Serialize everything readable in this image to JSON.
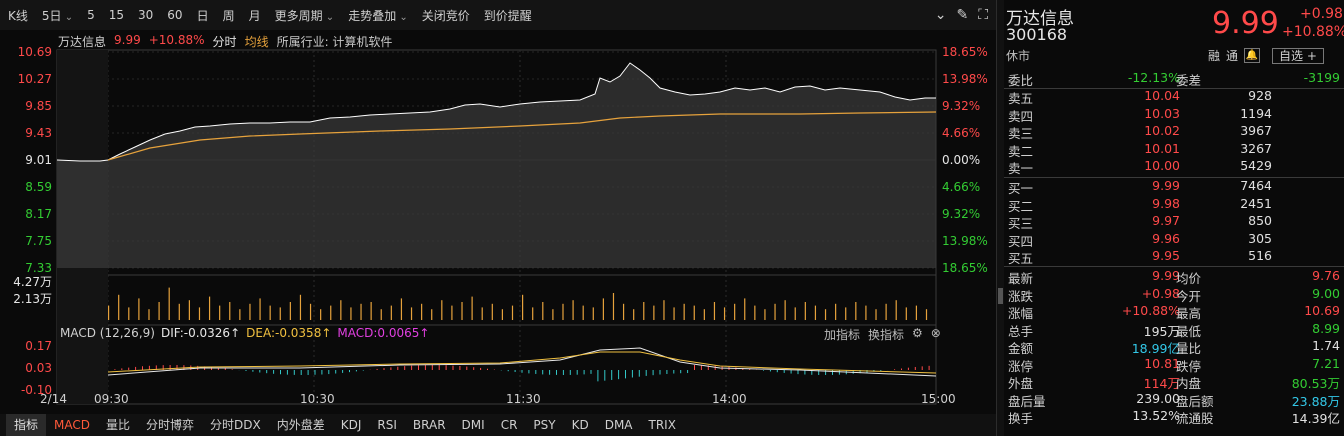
{
  "toolbar": {
    "items": [
      "K线",
      "5日",
      "5",
      "15",
      "30",
      "60",
      "日",
      "周",
      "月",
      "更多周期",
      "走势叠加",
      "关闭竞价",
      "到价提醒"
    ],
    "tools": [
      "collapse-icon",
      "draw-icon",
      "fullscreen-icon"
    ]
  },
  "chart_header": {
    "name": "万达信息",
    "price": "9.99",
    "pct": "+10.88%",
    "mode": "分时",
    "avg_label": "均线",
    "industry": "所属行业: 计算机软件"
  },
  "axis_left": [
    "10.69",
    "10.27",
    "9.85",
    "9.43",
    "9.01",
    "8.59",
    "8.17",
    "7.75",
    "7.33"
  ],
  "axis_right": [
    "18.65%",
    "13.98%",
    "9.32%",
    "4.66%",
    "0.00%",
    "4.66%",
    "9.32%",
    "13.98%",
    "18.65%"
  ],
  "volume_axis": [
    "4.27万",
    "2.13万"
  ],
  "macd": {
    "label": "MACD (12,26,9)",
    "dif": "DIF:-0.0326",
    "dea": "DEA:-0.0358",
    "macd": "MACD:0.0065",
    "axis": [
      "0.17",
      "0.03",
      "-0.10"
    ],
    "tools": [
      "加指标",
      "换指标"
    ]
  },
  "time_axis": [
    "2/14",
    "09:30",
    "10:30",
    "11:30",
    "14:00",
    "15:00"
  ],
  "tabs": [
    "指标",
    "MACD",
    "量比",
    "分时博弈",
    "分时DDX",
    "内外盘差",
    "KDJ",
    "RSI",
    "BRAR",
    "DMI",
    "CR",
    "PSY",
    "KD",
    "DMA",
    "TRIX"
  ],
  "panel": {
    "name": "万达信息",
    "code": "300168",
    "status": "休市",
    "price": "9.99",
    "change": "+0.98",
    "change_pct": "+10.88%",
    "flag1": "融",
    "flag2": "通",
    "watch": "自选 +",
    "commission": {
      "label1": "委比",
      "value1": "-12.13%",
      "label2": "委差",
      "value2": "-3199"
    },
    "asks": [
      {
        "label": "卖五",
        "price": "10.04",
        "vol": "928"
      },
      {
        "label": "卖四",
        "price": "10.03",
        "vol": "1194"
      },
      {
        "label": "卖三",
        "price": "10.02",
        "vol": "3967"
      },
      {
        "label": "卖二",
        "price": "10.01",
        "vol": "3267"
      },
      {
        "label": "卖一",
        "price": "10.00",
        "vol": "5429"
      }
    ],
    "bids": [
      {
        "label": "买一",
        "price": "9.99",
        "vol": "7464"
      },
      {
        "label": "买二",
        "price": "9.98",
        "vol": "2451"
      },
      {
        "label": "买三",
        "price": "9.97",
        "vol": "850"
      },
      {
        "label": "买四",
        "price": "9.96",
        "vol": "305"
      },
      {
        "label": "买五",
        "price": "9.95",
        "vol": "516"
      }
    ],
    "stats": [
      {
        "l1": "最新",
        "v1": "9.99",
        "c1": "red",
        "l2": "均价",
        "v2": "9.76",
        "c2": "red"
      },
      {
        "l1": "涨跌",
        "v1": "+0.98",
        "c1": "red",
        "l2": "今开",
        "v2": "9.00",
        "c2": "green"
      },
      {
        "l1": "涨幅",
        "v1": "+10.88%",
        "c1": "red",
        "l2": "最高",
        "v2": "10.69",
        "c2": "red"
      },
      {
        "l1": "总手",
        "v1": "195万",
        "c1": "white",
        "l2": "最低",
        "v2": "8.99",
        "c2": "green"
      },
      {
        "l1": "金额",
        "v1": "18.99亿",
        "c1": "cyan",
        "l2": "量比",
        "v2": "1.74",
        "c2": "white"
      },
      {
        "l1": "涨停",
        "v1": "10.81",
        "c1": "red",
        "l2": "跌停",
        "v2": "7.21",
        "c2": "green"
      },
      {
        "l1": "外盘",
        "v1": "114万",
        "c1": "red",
        "l2": "内盘",
        "v2": "80.53万",
        "c2": "green"
      },
      {
        "l1": "盘后量",
        "v1": "239.00",
        "c1": "white",
        "l2": "盘后额",
        "v2": "23.88万",
        "c2": "cyan"
      },
      {
        "l1": "换手",
        "v1": "13.52%",
        "c1": "white",
        "l2": "流通股",
        "v2": "14.39亿",
        "c2": "white"
      }
    ]
  },
  "colors": {
    "up": "#ff4a4a",
    "down": "#33cc33",
    "avg": "#e6a23c",
    "price_line": "#ffffff"
  }
}
